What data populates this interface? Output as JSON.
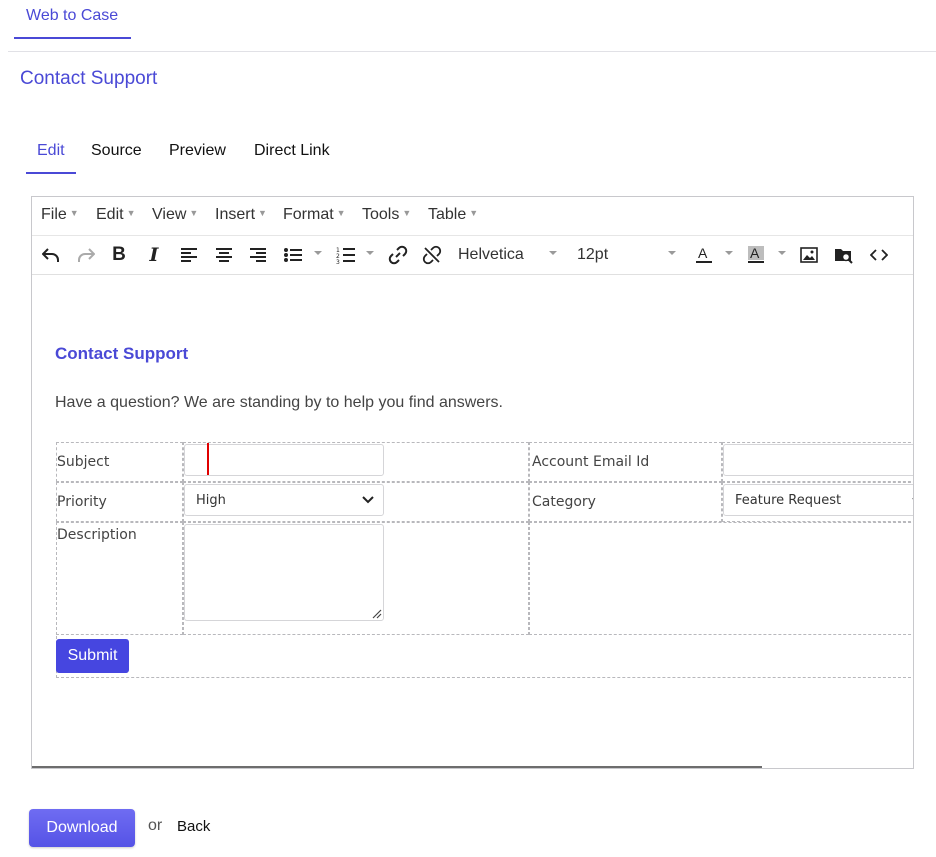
{
  "top_tab": {
    "label": "Web to Case"
  },
  "page_title": "Contact Support",
  "editor_tabs": [
    {
      "label": "Edit",
      "active": true
    },
    {
      "label": "Source",
      "active": false
    },
    {
      "label": "Preview",
      "active": false
    },
    {
      "label": "Direct Link",
      "active": false
    }
  ],
  "menu": [
    "File",
    "Edit",
    "View",
    "Insert",
    "Format",
    "Tools",
    "Table"
  ],
  "toolbar": {
    "font_family": "Helvetica",
    "font_size": "12pt",
    "icons": [
      "undo-icon",
      "redo-icon",
      "bold-icon",
      "italic-icon",
      "align-left-icon",
      "align-center-icon",
      "align-right-icon",
      "bullet-list-icon",
      "numbered-list-icon",
      "link-icon",
      "unlink-icon",
      "text-color-icon",
      "highlight-color-icon",
      "image-icon",
      "media-search-icon",
      "code-view-icon"
    ]
  },
  "form": {
    "title": "Contact Support",
    "intro": "Have a question? We are standing by to help you find answers.",
    "subject_label": "Subject",
    "subject_value": "",
    "account_email_label": "Account Email Id",
    "account_email_value": "",
    "priority_label": "Priority",
    "priority_value": "High",
    "category_label": "Category",
    "category_value": "Feature Request",
    "description_label": "Description",
    "description_value": "",
    "submit_label": "Submit"
  },
  "footer": {
    "download_label": "Download",
    "or_text": "or",
    "back_label": "Back"
  },
  "colors": {
    "accent": "#4a49d6",
    "submit_bg": "#4646e0",
    "download_bg": "#5f5cec",
    "cursor": "#e00000"
  }
}
